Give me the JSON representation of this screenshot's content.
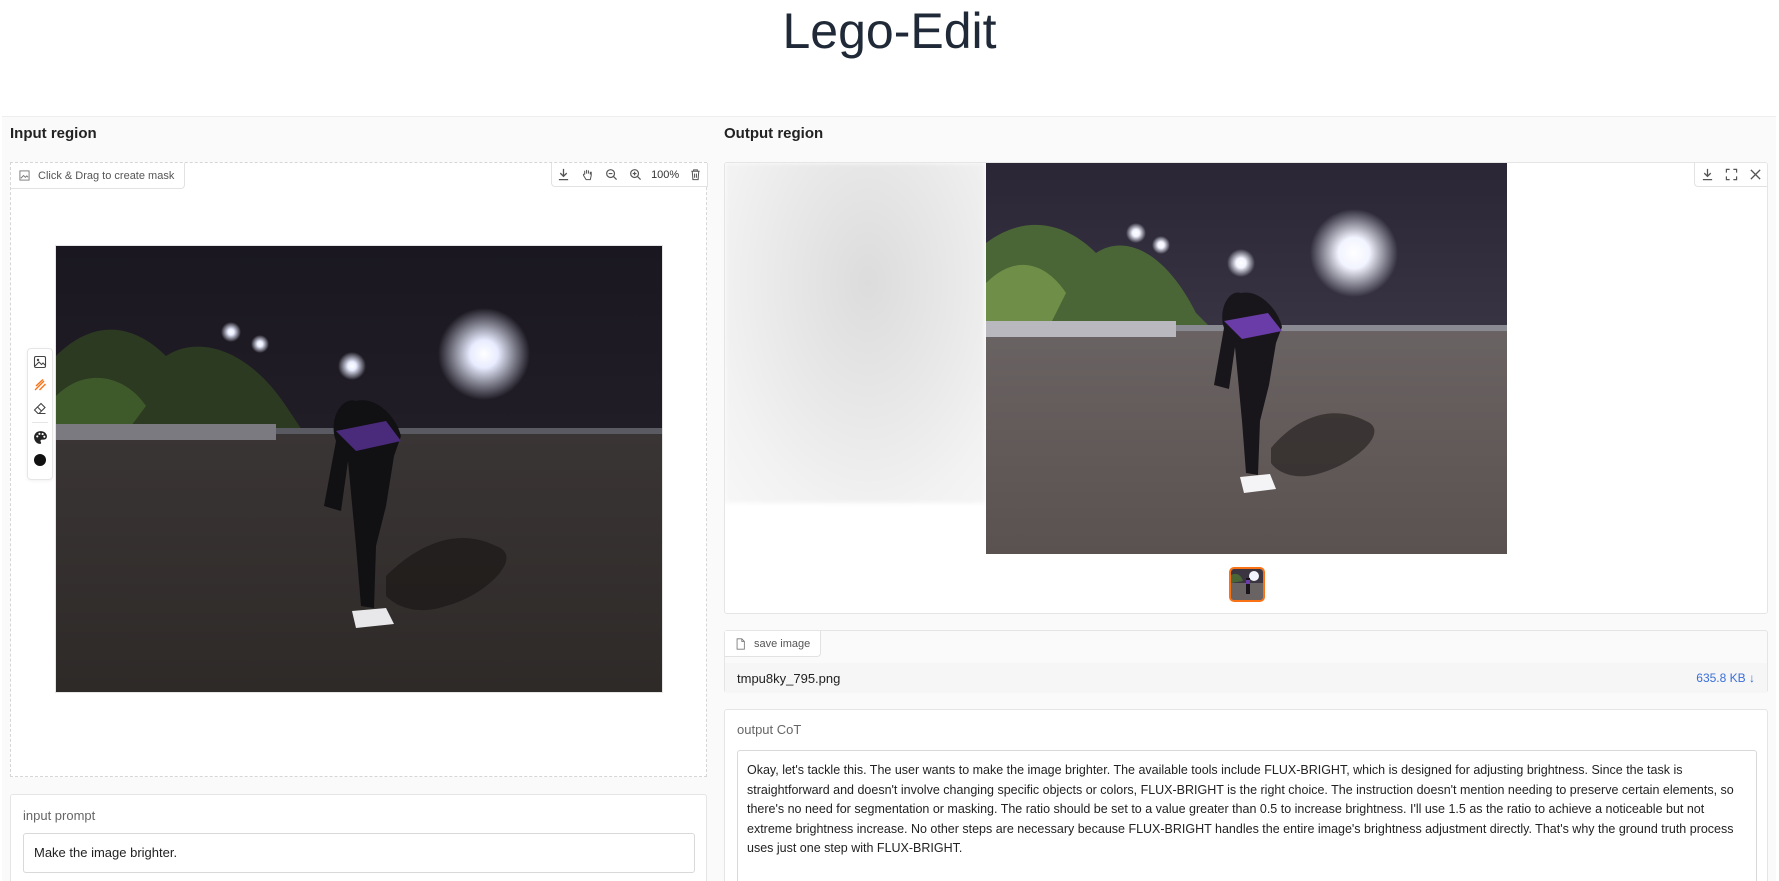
{
  "page": {
    "title": "Lego-Edit"
  },
  "input": {
    "section_title": "Input region",
    "mask_hint": "Click & Drag to create mask",
    "zoom_level": "100%",
    "prompt_label": "input prompt",
    "prompt_value": "Make the image brighter."
  },
  "output": {
    "section_title": "Output region",
    "save_label": "save image",
    "file_name": "tmpu8ky_795.png",
    "file_size": "635.8 KB ↓",
    "cot_label": "output CoT",
    "cot_text": "Okay, let's tackle this. The user wants to make the image brighter. The available tools include FLUX-BRIGHT, which is designed for adjusting brightness. Since the task is straightforward and doesn't involve changing specific objects or colors, FLUX-BRIGHT is the right choice. The instruction doesn't mention needing to preserve certain elements, so there's no need for segmentation or masking. The ratio should be set to a value greater than 0.5 to increase brightness. I'll use 1.5 as the ratio to achieve a noticeable but not extreme brightness increase. No other steps are necessary because FLUX-BRIGHT handles the entire image's brightness adjustment directly. That's why the ground truth process uses just one step with FLUX-BRIGHT."
  },
  "colors": {
    "accent": "#f97316",
    "link": "#3b6fd8"
  }
}
